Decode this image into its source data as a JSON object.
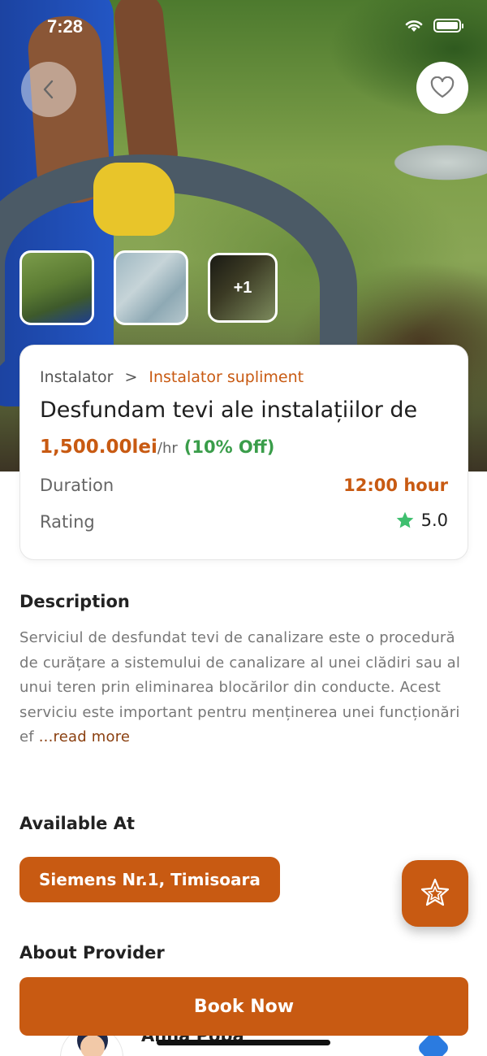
{
  "status_bar": {
    "time": "7:28"
  },
  "hero": {
    "more_images_label": "+1"
  },
  "service": {
    "category": "Instalator",
    "separator": ">",
    "subcategory": "Instalator supliment",
    "title": "Desfundam tevi ale instalațiilor de",
    "price": "1,500.00lei",
    "price_unit": "/hr",
    "discount": "(10% Off)",
    "duration_label": "Duration",
    "duration_value": "12:00 hour",
    "rating_label": "Rating",
    "rating_value": "5.0"
  },
  "description": {
    "title": "Description",
    "text": "Serviciul de desfundat tevi de canalizare este o procedură de curățare a sistemului de canalizare al unei clădiri sau al unui teren prin eliminarea blocărilor din conducte. Acest serviciu este important pentru menținerea unei funcționări ef",
    "read_more": " ...read more"
  },
  "availability": {
    "title": "Available At",
    "location": "Siemens Nr.1, Timisoara"
  },
  "provider": {
    "title": "About Provider",
    "name": "Anna Popa"
  },
  "actions": {
    "book_label": "Book Now"
  },
  "colors": {
    "accent": "#c85a12",
    "discount": "#3a9d4a",
    "star": "#3a9d4a",
    "verified": "#2b7be0"
  }
}
